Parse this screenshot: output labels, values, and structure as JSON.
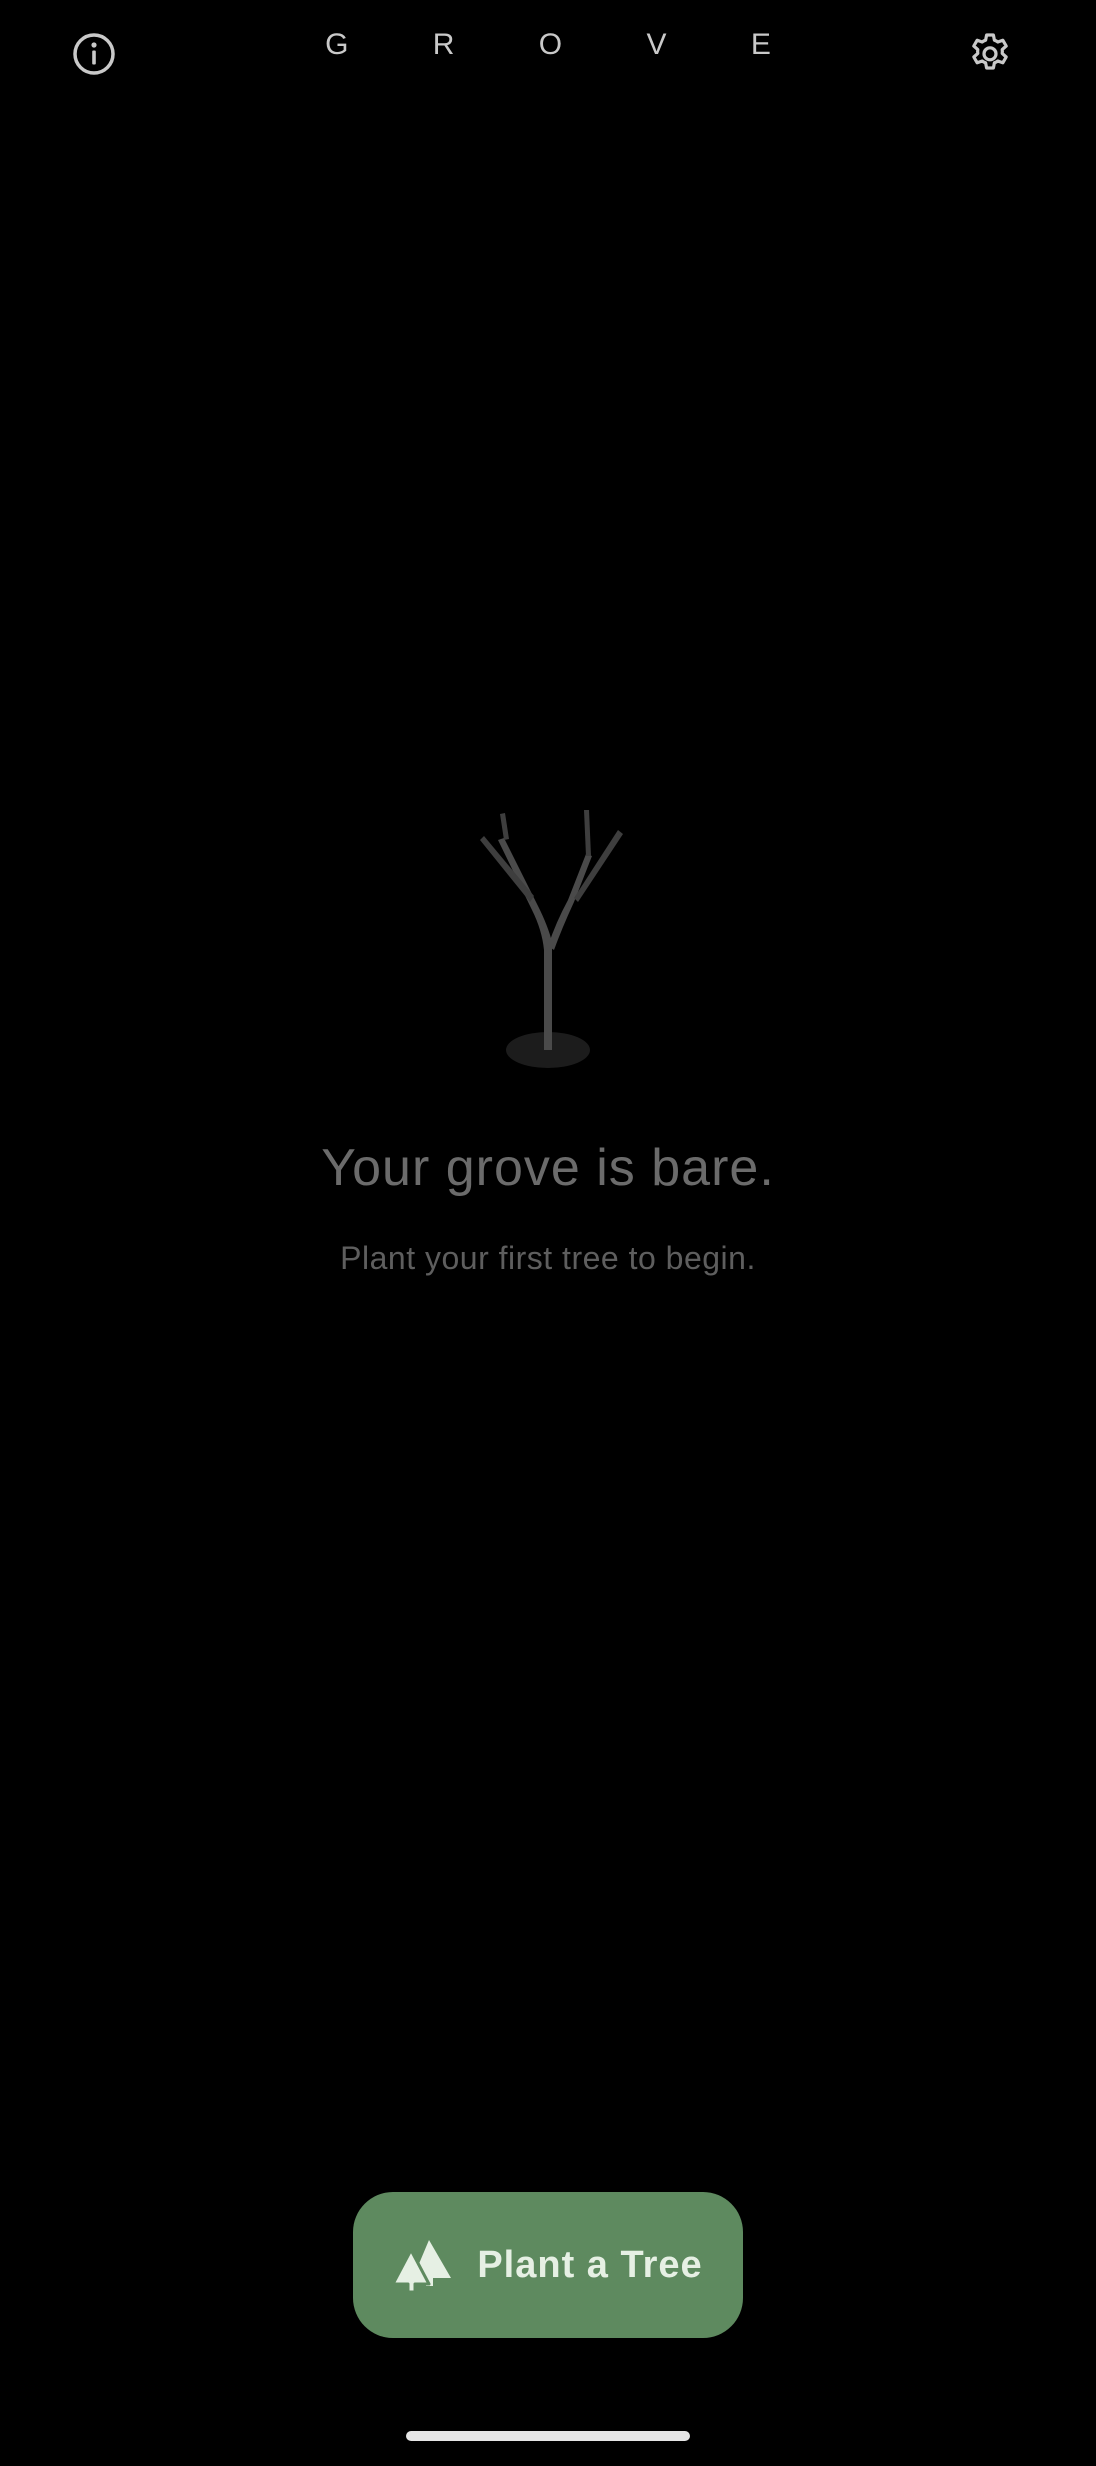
{
  "header": {
    "title": "G R O V E",
    "info_icon": "info-circle-icon",
    "settings_icon": "gear-icon"
  },
  "empty_state": {
    "illustration": "bare-tree-icon",
    "title": "Your grove is bare.",
    "subtitle": "Plant your first tree to begin."
  },
  "primary_action": {
    "label": "Plant a Tree",
    "icon": "trees-icon",
    "color": "#5e8a5f"
  },
  "system": {
    "home_indicator_color": "#e6e6e6"
  }
}
